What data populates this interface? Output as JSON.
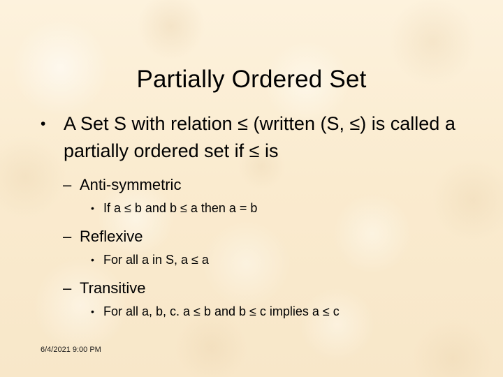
{
  "slide": {
    "title": "Partially Ordered Set",
    "background_color": "#fbeed4",
    "text_color": "#000000"
  },
  "markers": {
    "round_bullet": "•",
    "en_dash": "–"
  },
  "outline": {
    "main": {
      "level": 1,
      "marker": "•",
      "text": "A Set S with relation ≤ (written (S, ≤) is called a partially ordered set if ≤ is"
    },
    "properties": [
      {
        "level": 2,
        "marker": "–",
        "name": "Anti-symmetric",
        "detail": {
          "level": 3,
          "marker": "•",
          "text": "If a ≤ b and b ≤ a then a = b"
        }
      },
      {
        "level": 2,
        "marker": "–",
        "name": "Reflexive",
        "detail": {
          "level": 3,
          "marker": "•",
          "text": "For all a in S, a ≤ a"
        }
      },
      {
        "level": 2,
        "marker": "–",
        "name": "Transitive",
        "detail": {
          "level": 3,
          "marker": "•",
          "text": "For all a, b, c. a ≤ b and b ≤ c implies a ≤ c"
        }
      }
    ]
  },
  "footer": {
    "datetime": "6/4/2021 9:00 PM"
  }
}
